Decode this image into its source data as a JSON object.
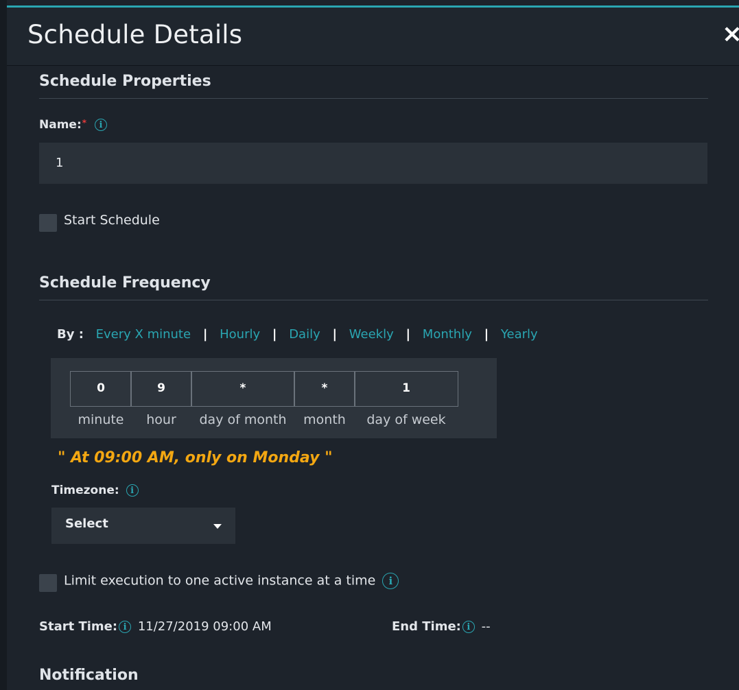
{
  "header": {
    "title": "Schedule Details",
    "close_label": "×"
  },
  "properties": {
    "section_title": "Schedule Properties",
    "name_label": "Name:",
    "name_required_mark": "*",
    "name_value": "1",
    "start_schedule_label": "Start Schedule",
    "start_schedule_checked": false
  },
  "frequency": {
    "section_title": "Schedule Frequency",
    "by_label": "By :",
    "options": [
      "Every X minute",
      "Hourly",
      "Daily",
      "Weekly",
      "Monthly",
      "Yearly"
    ],
    "separator": "|",
    "cron": {
      "minute": "0",
      "hour": "9",
      "day_of_month": "*",
      "month": "*",
      "day_of_week": "1",
      "labels": {
        "minute": "minute",
        "hour": "hour",
        "day_of_month": "day of month",
        "month": "month",
        "day_of_week": "day of week"
      }
    },
    "description": "\" At 09:00 AM, only on Monday \"",
    "timezone_label": "Timezone:",
    "timezone_value": "Select",
    "limit_label": "Limit execution to one active instance at a time",
    "limit_checked": false,
    "start_time_label": "Start Time:",
    "start_time_value": "11/27/2019 09:00 AM",
    "end_time_label": "End Time:",
    "end_time_value": "--"
  },
  "notification": {
    "section_title": "Notification"
  },
  "icons": {
    "info": "info-icon",
    "close": "close-icon",
    "caret": "caret-down-icon"
  },
  "colors": {
    "accent": "#2aa6b2",
    "warning": "#f3a712",
    "required": "#e53a3a",
    "background": "#1d232b"
  }
}
